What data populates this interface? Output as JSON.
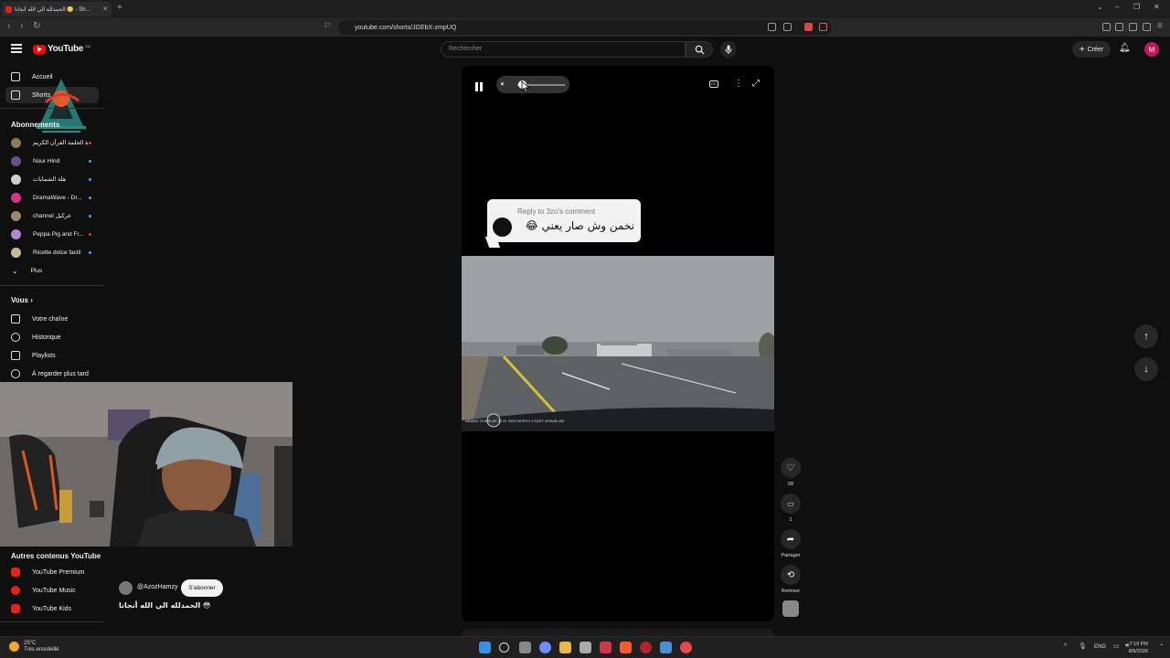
{
  "browser": {
    "tab_title": "الحمدلله الي الله أنجانا 😳 - Sh...",
    "tab_close": "✕",
    "new_tab": "+",
    "url": "youtube.com/shorts/JGEbX-zmpUQ"
  },
  "youtube": {
    "logo_text": "YouTube",
    "country_code": "MA",
    "search_placeholder": "Rechercher",
    "create_label": "Créer",
    "avatar_letter": "M"
  },
  "sidebar": {
    "main": [
      {
        "label": "Accueil",
        "icon": "home-icon"
      },
      {
        "label": "Shorts",
        "icon": "shorts-icon"
      }
    ],
    "subscriptions_title": "Abonnements",
    "subscriptions": [
      {
        "label": "قناة الحلمة القرآن الكريم",
        "color": "#8a7a5a",
        "live": true
      },
      {
        "label": "Nour Hind",
        "color": "#6a4f8a",
        "live": false
      },
      {
        "label": "هلة الشمايات",
        "color": "#cfcfcf",
        "live": false
      },
      {
        "label": "DramaWave - Dr...",
        "color": "#d6338a",
        "live": false
      },
      {
        "label": "channel عركيل",
        "color": "#9a8a6a",
        "live": false
      },
      {
        "label": "Peppa Pig and Fr...",
        "color": "#b08ad0",
        "live": true
      },
      {
        "label": "Ricette dolce facili",
        "color": "#c9b99a",
        "live": false
      }
    ],
    "more_label": "Plus",
    "you_title": "Vous",
    "you_items": [
      {
        "label": "Votre chaîne",
        "icon": "channel-icon"
      },
      {
        "label": "Historique",
        "icon": "history-icon"
      },
      {
        "label": "Playlists",
        "icon": "playlists-icon"
      },
      {
        "label": "À regarder plus tard",
        "icon": "watch-later-icon"
      }
    ],
    "other_title": "Autres contenus YouTube",
    "other_items": [
      {
        "label": "YouTube Premium"
      },
      {
        "label": "YouTube Music"
      },
      {
        "label": "YouTube Kids"
      }
    ]
  },
  "short": {
    "reply_header": "Reply to 3zo's comment",
    "reply_text": "نخمن وش صار يعني 😂",
    "channel": "@AzozHamzy",
    "subscribe_label": "S'abonner",
    "title": "الحمدلله الي الله أنجانا 😳",
    "likes": "58",
    "comments": "1",
    "share_label": "Partager",
    "remix_label": "Remixer",
    "dashcam_text": "ARABIC OVERLAY 00 01 2024   NORTH 1 EAST   4GNAB 000"
  },
  "taskbar": {
    "temp": "25°C",
    "weather": "Très ensoleillé",
    "lang": "ENG",
    "time": "7:19 PM",
    "date": "8/9/2026"
  }
}
